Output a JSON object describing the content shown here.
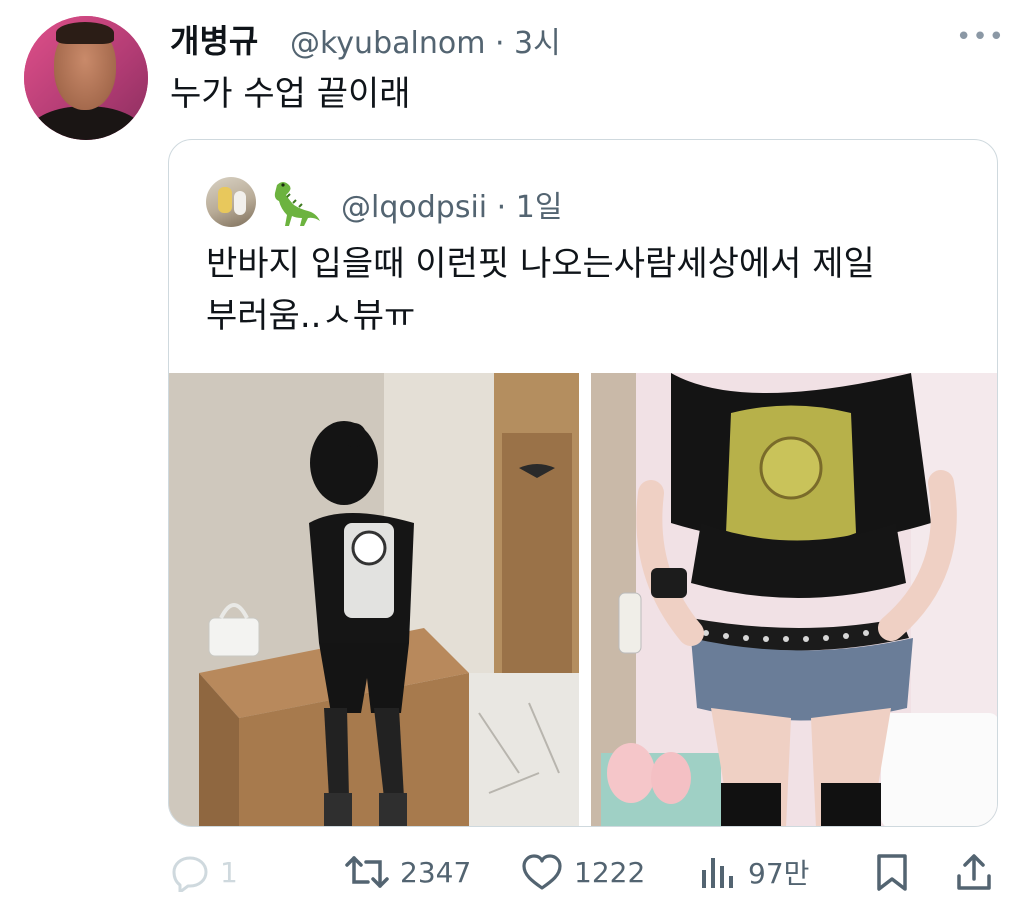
{
  "tweet": {
    "author_name": "개병규",
    "author_handle": "@kyubalnom",
    "time": "3시",
    "text": "누가 수업 끝이래",
    "more_icon": "more-horizontal-icon"
  },
  "quoted": {
    "handle": "@lqodpsii",
    "time": "1일",
    "emoji_name": "dinosaur-emoji",
    "text_line1": "반바지 입을때 이런핏 나오는사람세상에서 제일",
    "text_line2": "부러움..ㅅ뷰ㅠ",
    "photos": [
      "photo-girl-sitting-locker-room",
      "photo-girl-studded-belt"
    ]
  },
  "actions": {
    "reply_count": "1",
    "retweet_count": "2347",
    "like_count": "1222",
    "view_count": "97만"
  },
  "colors": {
    "text": "#0f1419",
    "secondary": "#536471",
    "border": "#cfd9de"
  }
}
